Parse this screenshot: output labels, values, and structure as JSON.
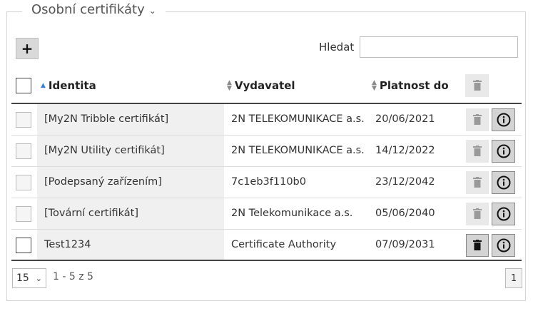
{
  "panel": {
    "title": "Osobní certifikáty"
  },
  "toolbar": {
    "add_label": "+",
    "search_label": "Hledat",
    "search_value": ""
  },
  "table": {
    "columns": [
      "Identita",
      "Vydavatel",
      "Platnost do"
    ],
    "rows": [
      {
        "identity": "[My2N Tribble certifikát]",
        "issuer": "2N TELEKOMUNIKACE a.s.",
        "valid_to": "20/06/2021"
      },
      {
        "identity": "[My2N Utility certifikát]",
        "issuer": "2N TELEKOMUNIKACE a.s.",
        "valid_to": "14/12/2022"
      },
      {
        "identity": "[Podepsaný zařízením]",
        "issuer": "7c1eb3f110b0",
        "valid_to": "23/12/2042"
      },
      {
        "identity": "[Tovární certifikát]",
        "issuer": "2N Telekomunikace a.s.",
        "valid_to": "05/06/2040"
      },
      {
        "identity": "Test1234",
        "issuer": "Certificate Authority",
        "valid_to": "07/09/2031"
      }
    ]
  },
  "pagination": {
    "page_size": "15",
    "range_text": "1 - 5 z 5",
    "current_page": "1"
  },
  "icons": {
    "add": "plus-icon",
    "delete": "trash-icon",
    "info": "info-icon",
    "sort": "sort-icon",
    "dropdown": "chevron-down-icon"
  },
  "colors": {
    "sort_active": "#3a7fd5",
    "header_line": "#444444",
    "button_bg": "#d4d4d4"
  }
}
